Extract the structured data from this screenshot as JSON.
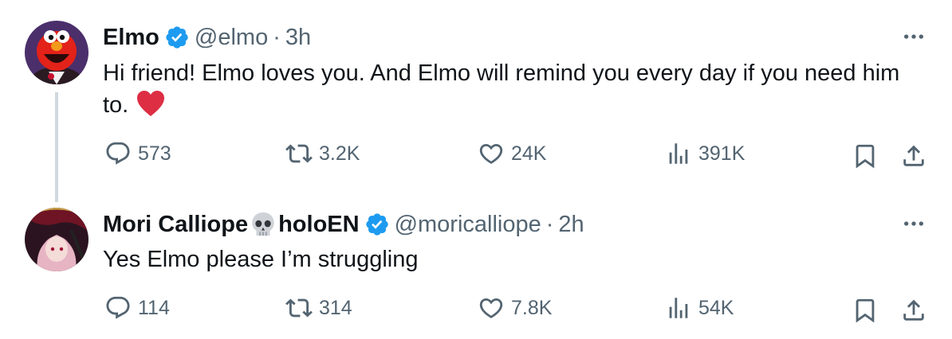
{
  "tweets": [
    {
      "display_name": "Elmo",
      "handle": "@elmo",
      "separator": "·",
      "time": "3h",
      "text": "Hi friend! Elmo loves you. And Elmo will remind you every day if you need him to.",
      "emoji": "red-heart",
      "verified": true,
      "stats": {
        "replies": "573",
        "retweets": "3.2K",
        "likes": "24K",
        "views": "391K"
      }
    },
    {
      "display_name_part1": "Mori Calliope",
      "display_name_emoji": "skull",
      "display_name_part2": "holoEN",
      "handle": "@moricalliope",
      "separator": "·",
      "time": "2h",
      "text": "Yes Elmo please I’m struggling",
      "verified": true,
      "stats": {
        "replies": "114",
        "retweets": "314",
        "likes": "7.8K",
        "views": "54K"
      }
    }
  ],
  "icons": [
    "reply-icon",
    "retweet-icon",
    "like-icon",
    "views-icon",
    "bookmark-icon",
    "share-icon",
    "more-icon",
    "verified-badge-icon"
  ],
  "colors": {
    "text": "#0f1419",
    "secondary": "#536471",
    "verified": "#1d9bf0",
    "thread_line": "#cfd9de",
    "heart": "#dd2e44"
  }
}
